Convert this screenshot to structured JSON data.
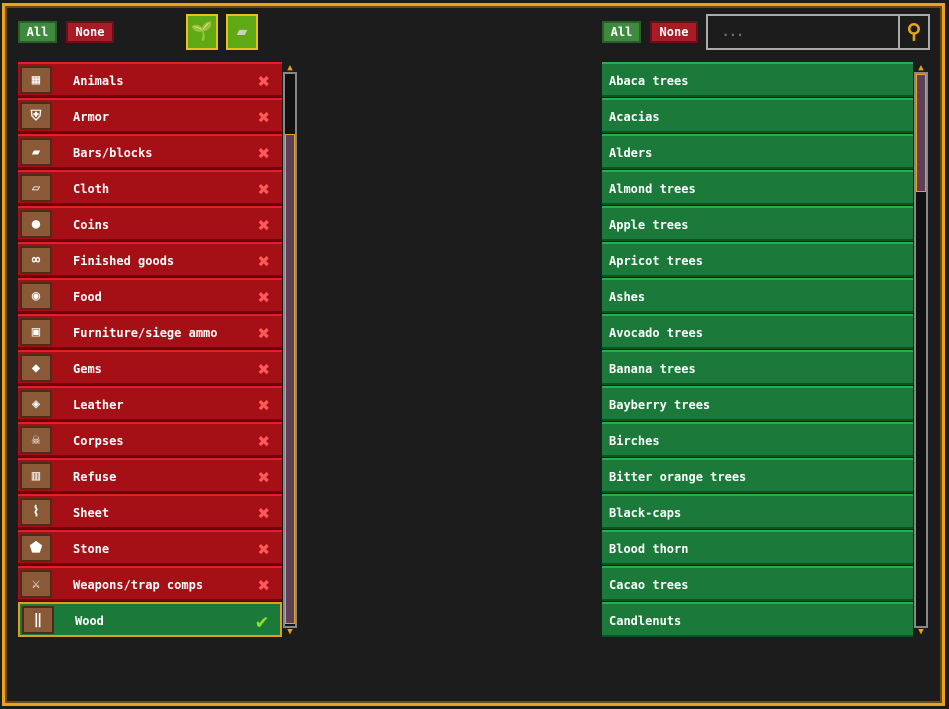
{
  "left": {
    "all_label": "All",
    "none_label": "None",
    "tools": [
      {
        "icon": "sapling-icon"
      },
      {
        "icon": "metal-bar-icon"
      }
    ],
    "items": [
      {
        "label": "Animals",
        "icon": "cage-icon",
        "enabled": false
      },
      {
        "label": "Armor",
        "icon": "armor-icon",
        "enabled": false
      },
      {
        "label": "Bars/blocks",
        "icon": "bar-icon",
        "enabled": false
      },
      {
        "label": "Cloth",
        "icon": "cloth-icon",
        "enabled": false
      },
      {
        "label": "Coins",
        "icon": "coins-icon",
        "enabled": false
      },
      {
        "label": "Finished goods",
        "icon": "finished-goods-icon",
        "enabled": false
      },
      {
        "label": "Food",
        "icon": "food-icon",
        "enabled": false
      },
      {
        "label": "Furniture/siege ammo",
        "icon": "furniture-icon",
        "enabled": false
      },
      {
        "label": "Gems",
        "icon": "gem-icon",
        "enabled": false
      },
      {
        "label": "Leather",
        "icon": "leather-icon",
        "enabled": false
      },
      {
        "label": "Corpses",
        "icon": "skull-icon",
        "enabled": false
      },
      {
        "label": "Refuse",
        "icon": "trash-icon",
        "enabled": false
      },
      {
        "label": "Sheet",
        "icon": "scroll-icon",
        "enabled": false
      },
      {
        "label": "Stone",
        "icon": "stone-icon",
        "enabled": false
      },
      {
        "label": "Weapons/trap comps",
        "icon": "sword-icon",
        "enabled": false
      },
      {
        "label": "Wood",
        "icon": "logs-icon",
        "enabled": true
      }
    ]
  },
  "right": {
    "all_label": "All",
    "none_label": "None",
    "search_placeholder": "...",
    "items": [
      "Abaca trees",
      "Acacias",
      "Alders",
      "Almond trees",
      "Apple trees",
      "Apricot trees",
      "Ashes",
      "Avocado trees",
      "Banana trees",
      "Bayberry trees",
      "Birches",
      "Bitter orange trees",
      "Black-caps",
      "Blood thorn",
      "Cacao trees",
      "Candlenuts"
    ]
  },
  "colors": {
    "enabled": "#1b7a3a",
    "disabled": "#a50f16",
    "frame": "#e8a21c"
  }
}
